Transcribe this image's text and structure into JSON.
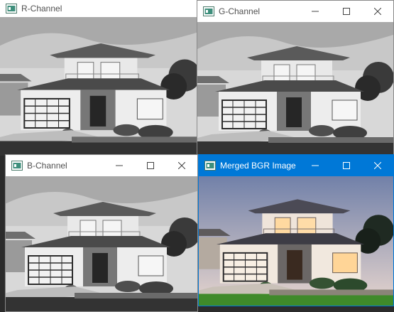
{
  "windows": {
    "r_channel": {
      "title": "R-Channel"
    },
    "g_channel": {
      "title": "G-Channel"
    },
    "b_channel": {
      "title": "B-Channel"
    },
    "merged": {
      "title": "Merged BGR Image"
    }
  },
  "colors": {
    "active_titlebar": "#0078d7",
    "desktop": "#2b2b2b"
  },
  "icons": {
    "app": "opencv-window-icon",
    "minimize": "minimize-icon",
    "maximize": "maximize-icon",
    "close": "close-icon"
  }
}
